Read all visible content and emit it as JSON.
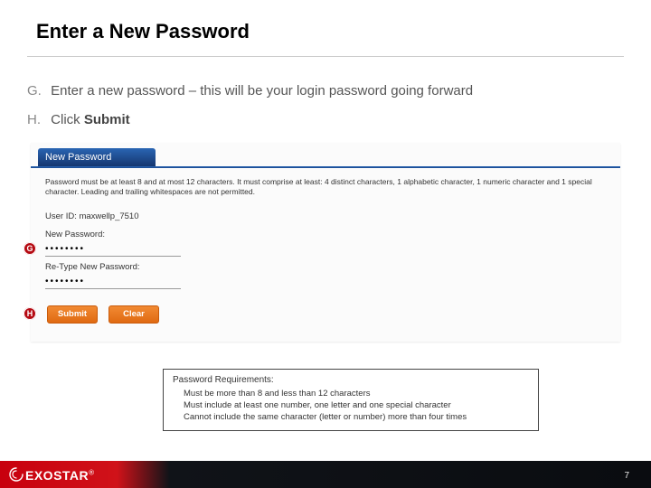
{
  "title": "Enter a New Password",
  "steps": {
    "g": {
      "letter": "G.",
      "text": "Enter a new password – this will be your login password going forward"
    },
    "h": {
      "letter": "H.",
      "prefix": "Click ",
      "bold": "Submit"
    }
  },
  "callouts": {
    "g": "G",
    "h": "H"
  },
  "form": {
    "tab": "New Password",
    "rule": "Password must be at least 8 and at most 12 characters. It must comprise at least: 4 distinct characters, 1 alphabetic character, 1 numeric character and 1 special character. Leading and trailing whitespaces are not permitted.",
    "user_id_label": "User ID:",
    "user_id_value": "maxwellp_7510",
    "new_pw_label": "New Password:",
    "new_pw_value": "••••••••",
    "retype_label": "Re-Type New Password:",
    "retype_value": "••••••••",
    "submit": "Submit",
    "clear": "Clear"
  },
  "requirements": {
    "title": "Password Requirements:",
    "lines": [
      "Must be more than 8 and less than 12 characters",
      "Must include at least one number, one letter and one special character",
      "Cannot include the same character (letter or number) more than four times"
    ]
  },
  "footer": {
    "brand": "EXOSTAR",
    "reg": "®",
    "page": "7"
  }
}
